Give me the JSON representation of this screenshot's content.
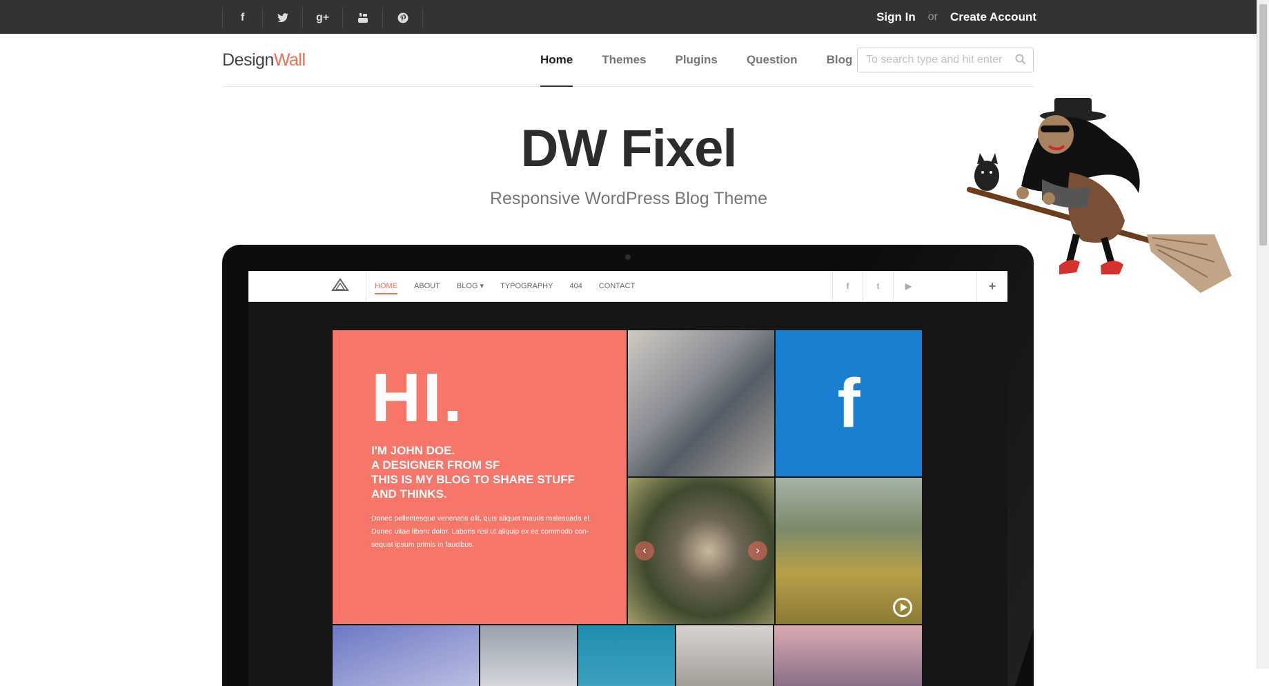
{
  "colors": {
    "topbar": "#333333",
    "brand_accent": "#f26c4f",
    "hero_tile": "#f6766a",
    "facebook_tile": "#1a7ed1"
  },
  "topbar": {
    "social": [
      {
        "icon": "facebook-icon",
        "glyph": "f"
      },
      {
        "icon": "twitter-icon",
        "glyph": "t"
      },
      {
        "icon": "google-plus-icon",
        "glyph": "g+"
      },
      {
        "icon": "youtube-icon",
        "glyph": "You"
      },
      {
        "icon": "pinterest-icon",
        "glyph": "p"
      }
    ],
    "sign_in": "Sign In",
    "or": "or",
    "create_account": "Create Account"
  },
  "header": {
    "logo_design": "Design",
    "logo_wall": "Wall",
    "nav": [
      "Home",
      "Themes",
      "Plugins",
      "Question",
      "Blog"
    ],
    "active_nav": "Home",
    "search_placeholder": "To search type and hit enter"
  },
  "hero": {
    "title": "DW Fixel",
    "subtitle": "Responsive WordPress Blog Theme"
  },
  "preview": {
    "menu": [
      "HOME",
      "ABOUT",
      "BLOG ▾",
      "TYPOGRAPHY",
      "404",
      "CONTACT"
    ],
    "social": [
      "f",
      "t",
      "▶"
    ],
    "plus": "+",
    "hi": "HI.",
    "headline_lines": [
      "I'M JOHN DOE.",
      "A DESIGNER FROM SF",
      "THIS IS MY BLOG TO SHARE STUFF",
      "AND THINKS."
    ],
    "body": "Donec pellentesque venenatis elit, quis aliquet mauris malesuada el. Donec uitae libero dolor. Laboris nisi ut aliquip ex ea commodo con- sequat ipsum primis in faucibus.",
    "facebook_glyph": "f",
    "arrow_left": "‹",
    "arrow_right": "›"
  }
}
